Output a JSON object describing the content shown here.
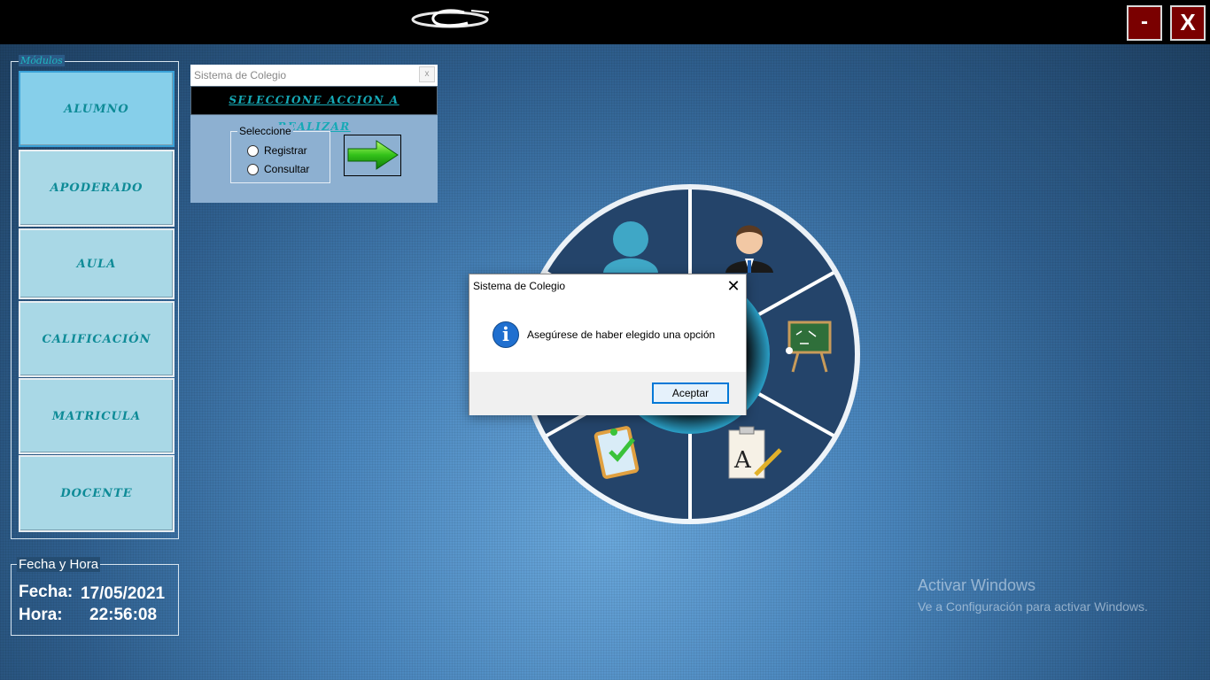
{
  "window": {
    "minimize_label": "-",
    "close_label": "X"
  },
  "modules": {
    "legend": "Módulos",
    "items": [
      {
        "label": "ALUMNO"
      },
      {
        "label": "APODERADO"
      },
      {
        "label": "AULA"
      },
      {
        "label": "CALIFICACIÓN"
      },
      {
        "label": "MATRICULA"
      },
      {
        "label": "DOCENTE"
      }
    ]
  },
  "datetime": {
    "legend": "Fecha y Hora",
    "date_label": "Fecha:",
    "date_value": "17/05/2021",
    "time_label": "Hora:",
    "time_value": "22:56:08"
  },
  "form": {
    "title": "Sistema de Colegio",
    "close_label": "x",
    "banner": "SELECCIONE ACCION A REALIZAR",
    "group_legend": "Seleccione",
    "option_register": "Registrar",
    "option_consult": "Consultar"
  },
  "dialog": {
    "title": "Sistema de Colegio",
    "close_label": "✕",
    "icon_glyph": "i",
    "message": "Asegúrese de haber elegido una opción",
    "ok_label": "Aceptar"
  },
  "watermark": {
    "title": "Activar Windows",
    "subtitle": "Ve a Configuración para activar Windows."
  },
  "colors": {
    "accent_teal": "#0e8b97",
    "window_button": "#7a0000",
    "dialog_button_border": "#0078d7"
  }
}
